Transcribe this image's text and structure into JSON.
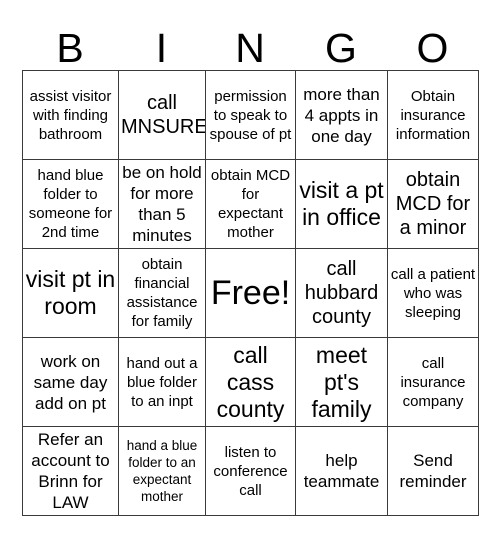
{
  "header": {
    "letters": [
      "B",
      "I",
      "N",
      "G",
      "O"
    ]
  },
  "grid": {
    "rows": [
      [
        {
          "text": "assist visitor with finding bathroom",
          "size": "fs-s"
        },
        {
          "text": "call MNSURE",
          "size": "fs-l"
        },
        {
          "text": "permission to speak to spouse of pt",
          "size": "fs-s"
        },
        {
          "text": "more than 4 appts in one day",
          "size": "fs-m"
        },
        {
          "text": "Obtain insurance information",
          "size": "fs-s"
        }
      ],
      [
        {
          "text": "hand blue folder to someone for 2nd time",
          "size": "fs-s"
        },
        {
          "text": "be on hold for more than 5 minutes",
          "size": "fs-m"
        },
        {
          "text": "obtain MCD for expectant mother",
          "size": "fs-s"
        },
        {
          "text": "visit a pt in office",
          "size": "fs-xl"
        },
        {
          "text": "obtain MCD for a minor",
          "size": "fs-l"
        }
      ],
      [
        {
          "text": "visit pt in room",
          "size": "fs-xl"
        },
        {
          "text": "obtain financial assistance for family",
          "size": "fs-s"
        },
        {
          "text": "Free!",
          "size": "fs-free"
        },
        {
          "text": "call hubbard county",
          "size": "fs-l"
        },
        {
          "text": "call a patient who was sleeping",
          "size": "fs-s"
        }
      ],
      [
        {
          "text": "work on same day add on pt",
          "size": "fs-m"
        },
        {
          "text": "hand out a blue folder to an inpt",
          "size": "fs-s"
        },
        {
          "text": "call cass county",
          "size": "fs-xl"
        },
        {
          "text": "meet pt's family",
          "size": "fs-xl"
        },
        {
          "text": "call insurance company",
          "size": "fs-s"
        }
      ],
      [
        {
          "text": "Refer an account to Brinn for LAW",
          "size": "fs-m"
        },
        {
          "text": "hand a blue folder to an expectant mother",
          "size": "fs-xs"
        },
        {
          "text": "listen to conference call",
          "size": "fs-s"
        },
        {
          "text": "help teammate",
          "size": "fs-m"
        },
        {
          "text": "Send reminder",
          "size": "fs-m"
        }
      ]
    ]
  }
}
